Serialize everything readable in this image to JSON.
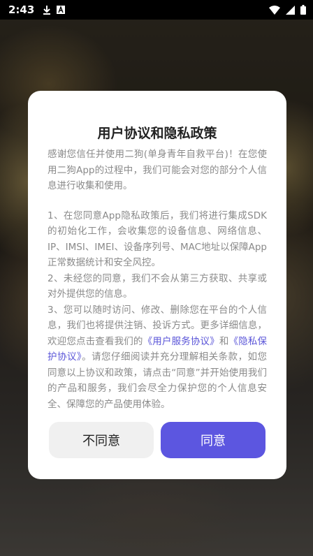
{
  "status_bar": {
    "time": "2:43",
    "icons": [
      "download-icon",
      "a-badge-icon",
      "wifi-icon",
      "signal-icon",
      "battery-icon"
    ]
  },
  "dialog": {
    "title": "用户协议和隐私政策",
    "intro": "感谢您信任并使用二狗(单身青年自救平台)！在您使用二狗App的过程中，我们可能会对您的部分个人信息进行收集和使用。",
    "item1": "1、在您同意App隐私政策后，我们将进行集成SDK的初始化工作，会收集您的设备信息、网络信息、IP、IMSI、IMEI、设备序列号、MAC地址以保障App正常数据统计和安全风控。",
    "item2": "2、未经您的同意，我们不会从第三方获取、共享或对外提供您的信息。",
    "item3_start": "3、您可以随时访问、修改、删除您在平台的个人信息，我们也将提供注销、投诉方式。更多详细信息，欢迎您点击查看我们的",
    "link_service": "《用户服务协议》",
    "and": "和",
    "link_privacy": "《隐私保护协议》",
    "item3_end": "。请您仔细阅读并充分理解相关条款，如您同意以上协议和政策，请点击“同意”并开始使用我们的产品和服务，我们会尽全力保护您的个人信息安全、保障您的产品使用体验。",
    "decline_label": "不同意",
    "agree_label": "同意"
  },
  "colors": {
    "accent": "#5c56e0",
    "link": "#5a55d8",
    "body_text": "#8a8a8a",
    "decline_bg": "#f0f0f0"
  }
}
